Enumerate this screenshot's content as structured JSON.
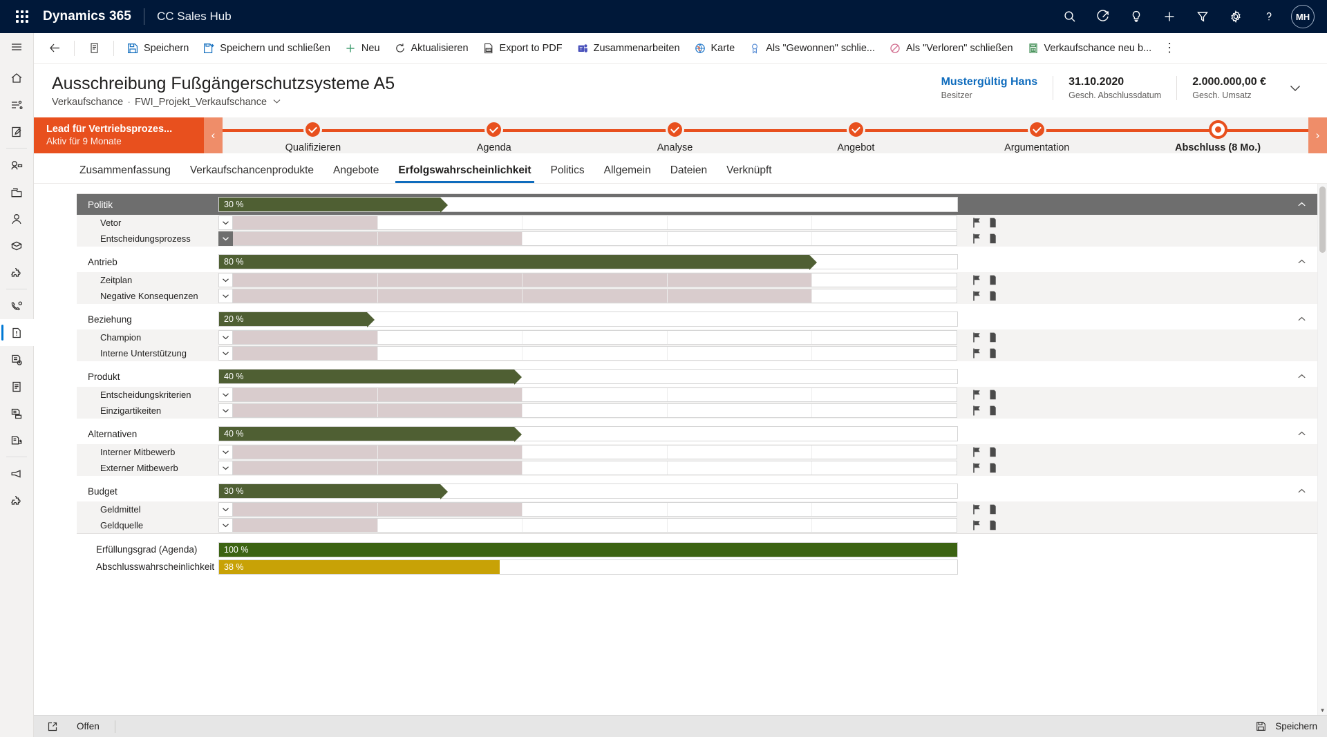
{
  "topbar": {
    "waffle": "app-launcher",
    "brand": "Dynamics 365",
    "app_name": "CC Sales Hub",
    "icons": [
      "search-icon",
      "assistant-icon",
      "insights-icon",
      "quick-create-icon",
      "filter-icon",
      "settings-icon",
      "help-icon"
    ],
    "avatar_initials": "MH"
  },
  "rail": {
    "items": [
      {
        "name": "hamburger-menu",
        "label": "Site Map"
      },
      {
        "name": "home-icon",
        "label": "Start"
      },
      {
        "name": "recent-icon",
        "label": "Zuletzt verwendet"
      },
      {
        "name": "pinned-icon",
        "label": "Angeheftet"
      },
      {
        "name": "activities-icon",
        "label": "Aktivitäten"
      },
      {
        "name": "accounts-icon",
        "label": "Firmen"
      },
      {
        "name": "contacts-icon",
        "label": "Kontakte"
      },
      {
        "name": "products-icon",
        "label": "Produkte"
      },
      {
        "name": "addons-icon",
        "label": "Add-ons"
      },
      {
        "name": "calls-icon",
        "label": "Anrufe"
      },
      {
        "name": "opportunities-icon",
        "label": "Verkaufschancen"
      },
      {
        "name": "quotes-icon",
        "label": "Angebote"
      },
      {
        "name": "orders-icon",
        "label": "Aufträge"
      },
      {
        "name": "invoices-icon",
        "label": "Rechnungen"
      },
      {
        "name": "documents-icon",
        "label": "Dokumente"
      },
      {
        "name": "campaign-icon",
        "label": "Kampagnen"
      },
      {
        "name": "settings-rail-icon",
        "label": "Einstellungen"
      }
    ],
    "active_index": 10
  },
  "commandbar": {
    "back": "back-arrow",
    "form_selector": "form-selector-icon",
    "buttons": [
      {
        "icon": "save-icon",
        "label": "Speichern"
      },
      {
        "icon": "save-close-icon",
        "label": "Speichern und schließen"
      },
      {
        "icon": "plus-icon",
        "label": "Neu"
      },
      {
        "icon": "refresh-icon",
        "label": "Aktualisieren"
      },
      {
        "icon": "pdf-icon",
        "label": "Export to PDF"
      },
      {
        "icon": "teams-icon",
        "label": "Zusammenarbeiten"
      },
      {
        "icon": "map-icon",
        "label": "Karte"
      },
      {
        "icon": "won-icon",
        "label": "Als \"Gewonnen\" schlie..."
      },
      {
        "icon": "lost-icon",
        "label": "Als \"Verloren\" schließen"
      },
      {
        "icon": "recalculate-icon",
        "label": "Verkaufschance neu b..."
      }
    ],
    "overflow": "⋮"
  },
  "record": {
    "title": "Ausschreibung Fußgängerschutzsysteme A5",
    "entity": "Verkaufschance",
    "separator": "·",
    "form_name": "FWI_Projekt_Verkaufschance",
    "form_chevron": "chevron-down-icon",
    "fields": [
      {
        "value": "Mustergültig Hans",
        "label": "Besitzer",
        "link": true
      },
      {
        "value": "31.10.2020",
        "label": "Gesch. Abschlussdatum",
        "link": false
      },
      {
        "value": "2.000.000,00 €",
        "label": "Gesch. Umsatz",
        "link": false
      }
    ],
    "expand": "chevron-down-icon"
  },
  "bpf": {
    "active_stage_title": "Lead für Vertriebsprozes...",
    "active_stage_sub": "Aktiv für 9 Monate",
    "prev": "‹",
    "next": "›",
    "steps": [
      {
        "label": "Qualifizieren",
        "state": "done"
      },
      {
        "label": "Agenda",
        "state": "done"
      },
      {
        "label": "Analyse",
        "state": "done"
      },
      {
        "label": "Angebot",
        "state": "done"
      },
      {
        "label": "Argumentation",
        "state": "done"
      },
      {
        "label": "Abschluss  (8 Mo.)",
        "state": "current"
      }
    ]
  },
  "tabs": [
    {
      "label": "Zusammenfassung",
      "active": false
    },
    {
      "label": "Verkaufschancenprodukte",
      "active": false
    },
    {
      "label": "Angebote",
      "active": false
    },
    {
      "label": "Erfolgswahrscheinlichkeit",
      "active": true
    },
    {
      "label": "Politics",
      "active": false
    },
    {
      "label": "Allgemein",
      "active": false
    },
    {
      "label": "Dateien",
      "active": false
    },
    {
      "label": "Verknüpft",
      "active": false
    }
  ],
  "chart_data": {
    "type": "bar",
    "title": "Erfolgswahrscheinlichkeit",
    "xlabel": "",
    "ylabel": "",
    "xlim": [
      0,
      100
    ],
    "unit": "%",
    "segments_per_detail": 5,
    "groups": [
      {
        "name": "Politik",
        "value": 30,
        "value_text": "30 %",
        "header_style": "dark",
        "collapse": "chevron-up-icon",
        "details": [
          {
            "name": "Vetor",
            "filled": 1,
            "selected": false
          },
          {
            "name": "Entscheidungsprozess",
            "filled": 2,
            "selected": true
          }
        ]
      },
      {
        "name": "Antrieb",
        "value": 80,
        "value_text": "80 %",
        "header_style": "plain",
        "collapse": "chevron-up-icon",
        "details": [
          {
            "name": "Zeitplan",
            "filled": 4,
            "selected": false
          },
          {
            "name": "Negative Konsequenzen",
            "filled": 4,
            "selected": false
          }
        ]
      },
      {
        "name": "Beziehung",
        "value": 20,
        "value_text": "20 %",
        "header_style": "plain",
        "collapse": "chevron-up-icon",
        "details": [
          {
            "name": "Champion",
            "filled": 1,
            "selected": false
          },
          {
            "name": "Interne Unterstützung",
            "filled": 1,
            "selected": false
          }
        ]
      },
      {
        "name": "Produkt",
        "value": 40,
        "value_text": "40 %",
        "header_style": "plain",
        "collapse": "chevron-up-icon",
        "details": [
          {
            "name": "Entscheidungskriterien",
            "filled": 2,
            "selected": false
          },
          {
            "name": "Einzigartikeiten",
            "filled": 2,
            "selected": false
          }
        ]
      },
      {
        "name": "Alternativen",
        "value": 40,
        "value_text": "40 %",
        "header_style": "plain",
        "collapse": "chevron-up-icon",
        "details": [
          {
            "name": "Interner Mitbewerb",
            "filled": 2,
            "selected": false
          },
          {
            "name": "Externer Mitbewerb",
            "filled": 2,
            "selected": false
          }
        ]
      },
      {
        "name": "Budget",
        "value": 30,
        "value_text": "30 %",
        "header_style": "plain",
        "collapse": "chevron-up-icon",
        "details": [
          {
            "name": "Geldmittel",
            "filled": 2,
            "selected": false
          },
          {
            "name": "Geldquelle",
            "filled": 1,
            "selected": false
          }
        ]
      }
    ],
    "summary": [
      {
        "name": "Erfüllungsgrad (Agenda)",
        "value": 100,
        "value_text": "100 %",
        "color": "#3c6312"
      },
      {
        "name": "Abschlusswahrscheinlichkeit",
        "value": 38,
        "value_text": "38 %",
        "color": "#c8a206"
      }
    ],
    "detail_icons": [
      "flag-icon",
      "note-icon"
    ],
    "colors": {
      "group_bar": "#4f5f33",
      "segment_filled": "#d9cccd",
      "accent": "#0f6cbd",
      "bpf": "#e8501e",
      "header": "#001839"
    }
  },
  "footer": {
    "expand_icon": "popout-icon",
    "status": "Offen",
    "save_icon": "save-icon",
    "save_label": "Speichern"
  }
}
